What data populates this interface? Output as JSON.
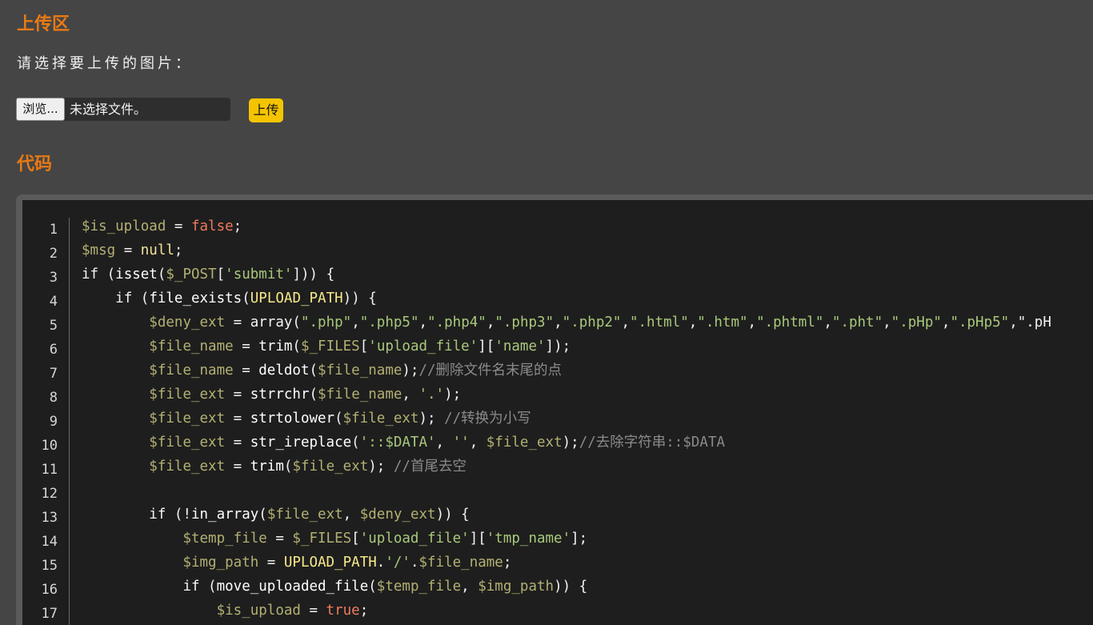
{
  "upload_section": {
    "title": "上传区",
    "prompt": "请选择要上传的图片：",
    "browse_label": "浏览...",
    "file_status": "未选择文件。",
    "upload_label": "上传"
  },
  "code_section": {
    "title": "代码",
    "line_numbers": [
      "1",
      "2",
      "3",
      "4",
      "5",
      "6",
      "7",
      "8",
      "9",
      "10",
      "11",
      "12",
      "13",
      "14",
      "15",
      "16",
      "17"
    ],
    "lines": [
      "$is_upload = false;",
      "$msg = null;",
      "if (isset($_POST['submit'])) {",
      "    if (file_exists(UPLOAD_PATH)) {",
      "        $deny_ext = array(\".php\",\".php5\",\".php4\",\".php3\",\".php2\",\".html\",\".htm\",\".phtml\",\".pht\",\".pHp\",\".pHp5\",\".pH",
      "        $file_name = trim($_FILES['upload_file']['name']);",
      "        $file_name = deldot($file_name);//删除文件名末尾的点",
      "        $file_ext = strrchr($file_name, '.');",
      "        $file_ext = strtolower($file_ext); //转换为小写",
      "        $file_ext = str_ireplace('::$DATA', '', $file_ext);//去除字符串::$DATA",
      "        $file_ext = trim($file_ext); //首尾去空",
      "",
      "        if (!in_array($file_ext, $deny_ext)) {",
      "            $temp_file = $_FILES['upload_file']['tmp_name'];",
      "            $img_path = UPLOAD_PATH.'/'.$file_name;",
      "            if (move_uploaded_file($temp_file, $img_path)) {",
      "                $is_upload = true;"
    ]
  }
}
